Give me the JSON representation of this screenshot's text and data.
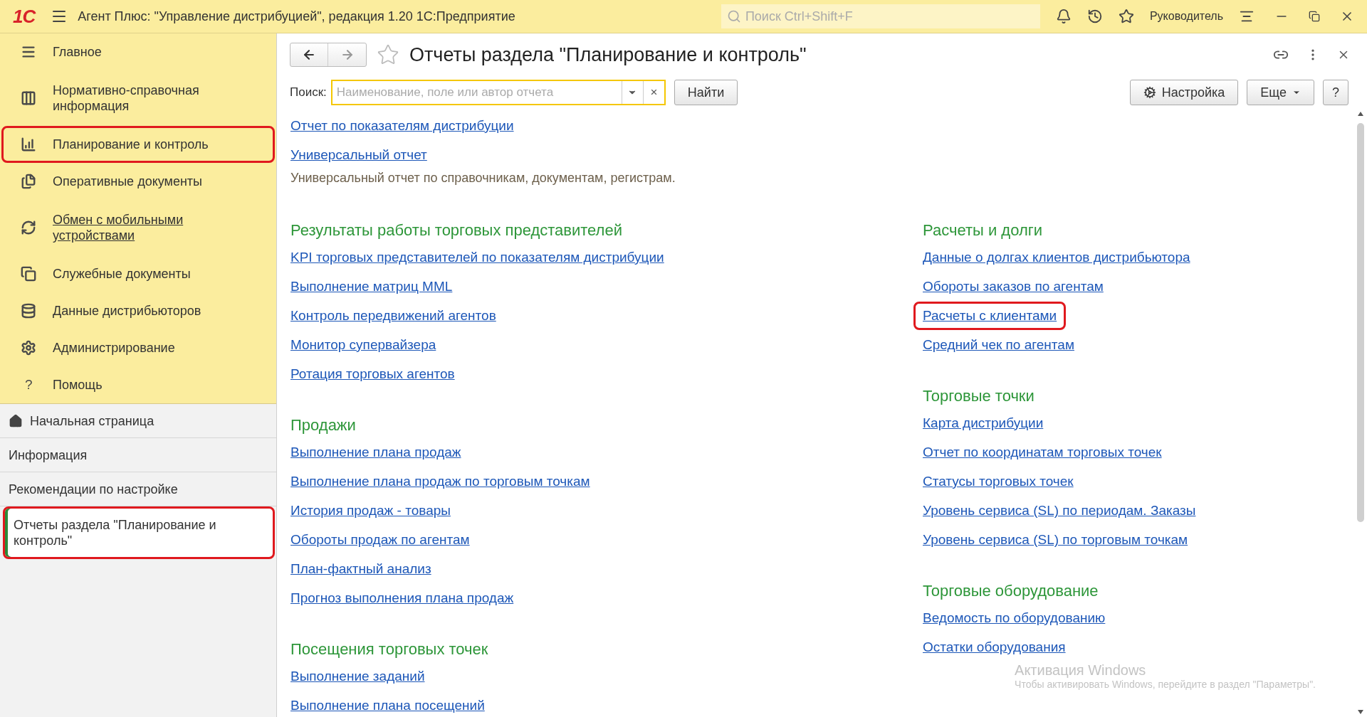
{
  "app_bar": {
    "logo": "1С",
    "title": "Агент Плюс: \"Управление дистрибуцией\", редакция 1.20 1С:Предприятие",
    "search": {
      "placeholder": "Поиск Ctrl+Shift+F"
    },
    "user": "Руководитель"
  },
  "sections_panel": {
    "items": [
      {
        "label": "Главное",
        "highlighted": false,
        "hovered": false
      },
      {
        "label": "Нормативно-справочная информация",
        "highlighted": false,
        "hovered": false
      },
      {
        "label": "Планирование и контроль",
        "highlighted": true,
        "hovered": false
      },
      {
        "label": "Оперативные документы",
        "highlighted": false,
        "hovered": false
      },
      {
        "label": "Обмен с мобильными устройствами",
        "highlighted": false,
        "hovered": true
      },
      {
        "label": "Служебные документы",
        "highlighted": false,
        "hovered": false
      },
      {
        "label": "Данные дистрибьюторов",
        "highlighted": false,
        "hovered": false
      },
      {
        "label": "Администрирование",
        "highlighted": false,
        "hovered": false
      },
      {
        "label": "Помощь",
        "glyph": "?",
        "highlighted": false,
        "hovered": false
      }
    ]
  },
  "open_windows": [
    {
      "label": "Начальная страница",
      "selected": false,
      "highlighted": false
    },
    {
      "label": "Информация",
      "selected": false,
      "highlighted": false
    },
    {
      "label": "Рекомендации по настройке",
      "selected": false,
      "highlighted": false
    },
    {
      "label": "Отчеты раздела \"Планирование и контроль\"",
      "selected": true,
      "highlighted": true
    }
  ],
  "form": {
    "title": "Отчеты раздела \"Планирование и контроль\"",
    "search": {
      "label": "Поиск:",
      "placeholder": "Наименование, поле или автор отчета",
      "clear": "×",
      "button": "Найти"
    },
    "buttons": [
      {
        "kind": "settings",
        "label": "Настройка"
      },
      {
        "kind": "menu",
        "label": "Еще"
      },
      {
        "kind": "plain",
        "label": "?"
      }
    ],
    "top_links": [
      {
        "label": "Отчет по показателям дистрибуции"
      },
      {
        "label": "Универсальный отчет",
        "description": "Универсальный отчет по справочникам, документам, регистрам."
      }
    ],
    "columns": [
      [
        {
          "title": "Результаты работы торговых представителей",
          "links": [
            {
              "label": "KPI торговых представителей по показателям дистрибуции",
              "highlighted": false
            },
            {
              "label": "Выполнение матриц MML",
              "highlighted": false
            },
            {
              "label": "Контроль передвижений агентов",
              "highlighted": false
            },
            {
              "label": "Монитор супервайзера",
              "highlighted": false
            },
            {
              "label": "Ротация торговых агентов",
              "highlighted": false
            }
          ]
        },
        {
          "title": "Продажи",
          "links": [
            {
              "label": "Выполнение плана продаж",
              "highlighted": false
            },
            {
              "label": "Выполнение плана продаж по торговым точкам",
              "highlighted": false
            },
            {
              "label": "История продаж - товары",
              "highlighted": false
            },
            {
              "label": "Обороты продаж по агентам",
              "highlighted": false
            },
            {
              "label": "План-фактный анализ",
              "highlighted": false
            },
            {
              "label": "Прогноз выполнения плана продаж",
              "highlighted": false
            }
          ]
        },
        {
          "title": "Посещения торговых точек",
          "links": [
            {
              "label": "Выполнение заданий",
              "highlighted": false
            },
            {
              "label": "Выполнение плана посещений",
              "highlighted": false
            }
          ]
        }
      ],
      [
        {
          "title": "Расчеты и долги",
          "links": [
            {
              "label": "Данные о долгах клиентов дистрибьютора",
              "highlighted": false
            },
            {
              "label": "Обороты заказов по агентам",
              "highlighted": false
            },
            {
              "label": "Расчеты с клиентами",
              "highlighted": true
            },
            {
              "label": "Средний чек по агентам",
              "highlighted": false
            }
          ]
        },
        {
          "title": "Торговые точки",
          "links": [
            {
              "label": "Карта дистрибуции",
              "highlighted": false
            },
            {
              "label": "Отчет по координатам торговых точек",
              "highlighted": false
            },
            {
              "label": "Статусы торговых точек",
              "highlighted": false
            },
            {
              "label": "Уровень сервиса (SL) по периодам. Заказы",
              "highlighted": false
            },
            {
              "label": "Уровень сервиса (SL) по торговым точкам",
              "highlighted": false
            }
          ]
        },
        {
          "title": "Торговые оборудование",
          "links": [
            {
              "label": "Ведомость по оборудованию",
              "highlighted": false
            },
            {
              "label": "Остатки оборудования",
              "highlighted": false
            }
          ]
        }
      ]
    ]
  },
  "os_notice": {
    "title": "Активация Windows",
    "text": "Чтобы активировать Windows, перейдите в раздел \"Параметры\"."
  }
}
